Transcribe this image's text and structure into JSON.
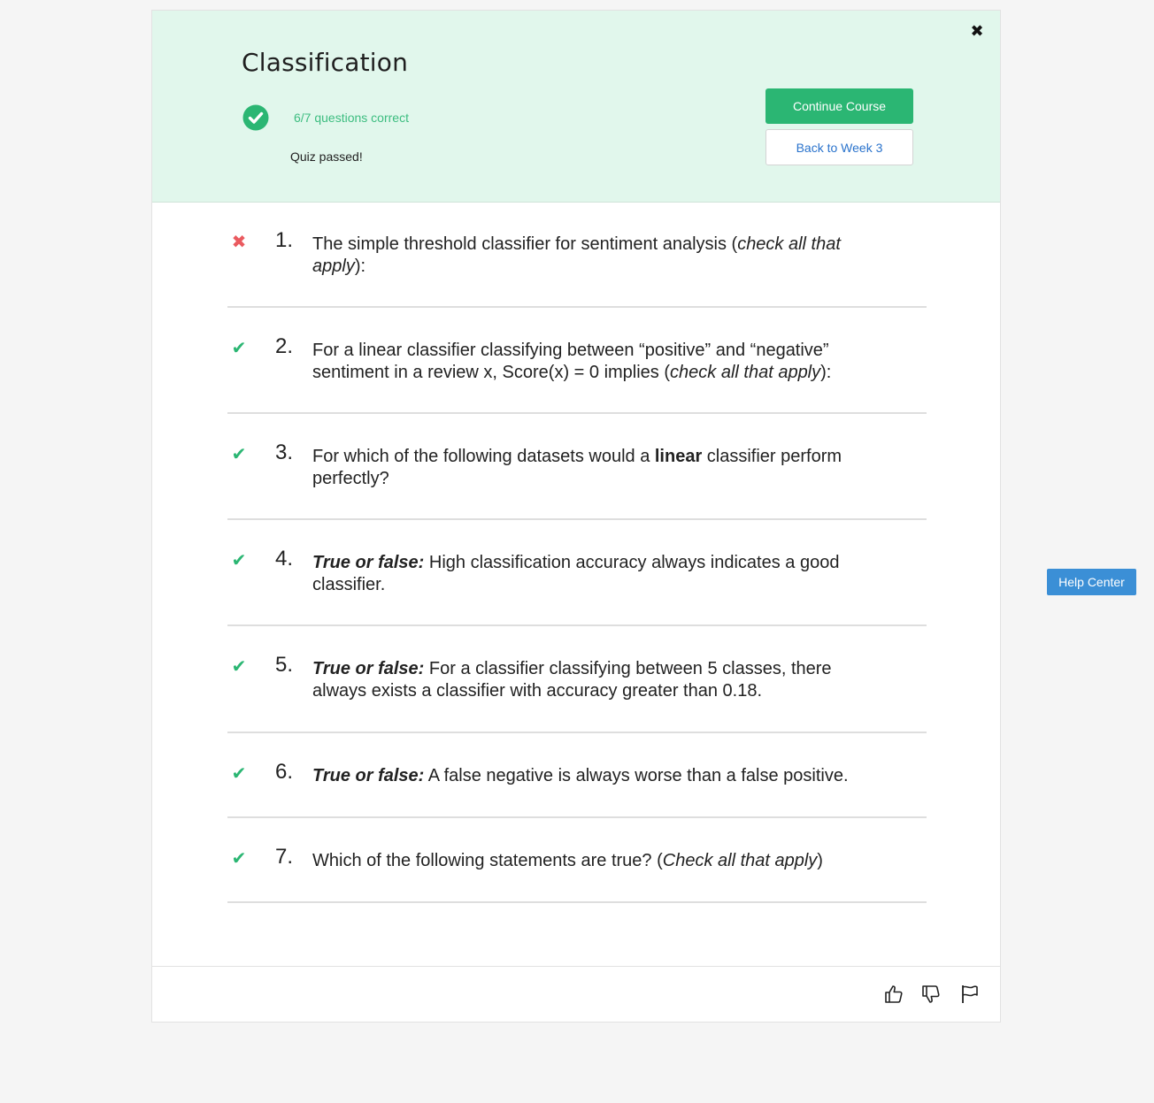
{
  "header": {
    "title": "Classification",
    "score": "6/7 questions correct",
    "status": "Quiz passed!",
    "continue_label": "Continue Course",
    "back_label": "Back to Week 3",
    "close_icon": "close-icon",
    "pass_icon": "check-circle-icon"
  },
  "questions": [
    {
      "num": "1.",
      "correct": false,
      "parts": [
        {
          "t": "The simple threshold classifier for sentiment analysis ("
        },
        {
          "t": "check all that apply",
          "i": true
        },
        {
          "t": "):"
        }
      ]
    },
    {
      "num": "2.",
      "correct": true,
      "parts": [
        {
          "t": "For a linear classifier classifying between “positive” and “negative” sentiment in a review x, Score(x) = 0 implies ("
        },
        {
          "t": "check all that apply",
          "i": true
        },
        {
          "t": "):"
        }
      ]
    },
    {
      "num": "3.",
      "correct": true,
      "parts": [
        {
          "t": "For which of the following datasets would a "
        },
        {
          "t": "linear",
          "b": true
        },
        {
          "t": " classifier perform perfectly?"
        }
      ]
    },
    {
      "num": "4.",
      "correct": true,
      "parts": [
        {
          "t": "True or false:",
          "b": true,
          "i": true
        },
        {
          "t": " High classification accuracy always indicates a good classifier."
        }
      ]
    },
    {
      "num": "5.",
      "correct": true,
      "parts": [
        {
          "t": "True or false:",
          "b": true,
          "i": true
        },
        {
          "t": " For a classifier classifying between 5 classes, there always exists a classifier with accuracy greater than 0.18."
        }
      ]
    },
    {
      "num": "6.",
      "correct": true,
      "parts": [
        {
          "t": "True or false:",
          "b": true,
          "i": true
        },
        {
          "t": " A false negative is always worse than a false positive."
        }
      ]
    },
    {
      "num": "7.",
      "correct": true,
      "parts": [
        {
          "t": "Which of the following statements are true? ("
        },
        {
          "t": "Check all that apply",
          "i": true
        },
        {
          "t": ")"
        }
      ]
    }
  ],
  "footer": {
    "like_icon": "thumbs-up-icon",
    "dislike_icon": "thumbs-down-icon",
    "flag_icon": "flag-icon"
  },
  "help": {
    "label": "Help Center"
  },
  "colors": {
    "header_bg": "#e1f7ec",
    "accent_green": "#2bb673",
    "wrong_red": "#ea5a5f",
    "link_blue": "#2a73cc",
    "help_blue": "#3b8fd6"
  }
}
